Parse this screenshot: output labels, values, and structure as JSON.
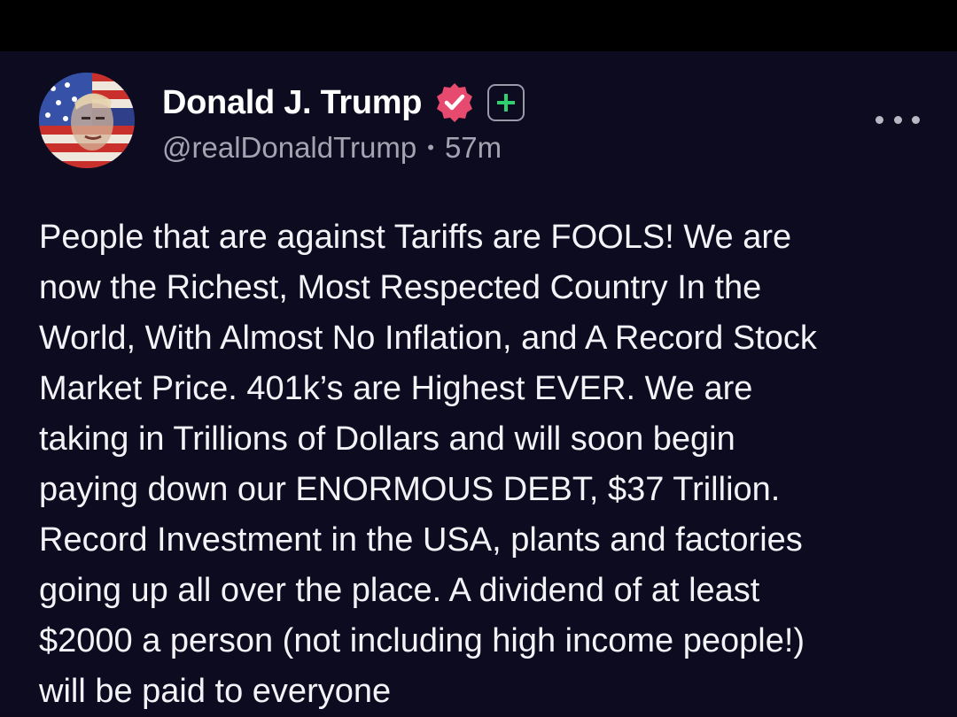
{
  "post": {
    "author": {
      "display_name": "Donald J. Trump",
      "handle": "@realDonaldTrump",
      "separator": "•",
      "time_ago": "57m"
    },
    "verified_badge_icon": "verified-check-icon",
    "plus_badge_icon": "plus-icon",
    "more_icon": "more-options-icon",
    "text_lines": [
      "People that are against Tariffs are FOOLS! We are",
      "now the Richest, Most Respected Country In the",
      "World, With Almost No Inflation, and A Record Stock",
      "Market Price. 401k’s are Highest EVER. We are",
      "taking in Trillions of Dollars and will soon begin",
      "paying down our ENORMOUS DEBT, $37 Trillion.",
      "Record Investment in the USA, plants and factories",
      "going up all over the place. A dividend of at least",
      "$2000 a person (not including high income people!)",
      "will be paid to everyone"
    ]
  },
  "colors": {
    "background": "#0d0b1f",
    "verified_badge": "#e64a6e",
    "plus_icon": "#2fd16f",
    "text": "#f3f2f7",
    "meta_text": "#a4a3b2"
  }
}
